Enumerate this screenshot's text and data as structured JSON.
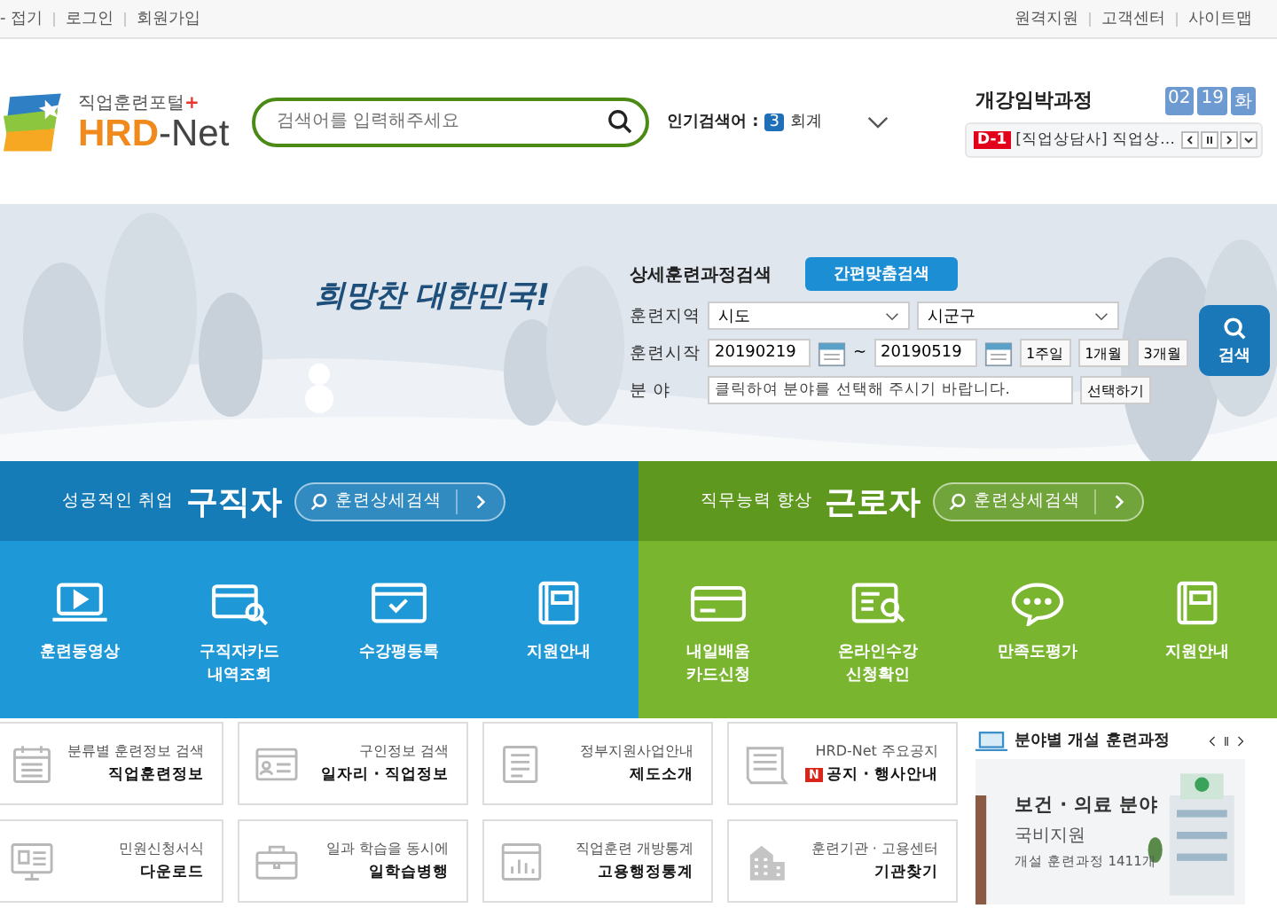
{
  "top_bar": {
    "left_links": [
      "- 접기",
      "로그인",
      "회원가입"
    ],
    "right_links": [
      "원격지원",
      "고객센터",
      "사이트맵"
    ]
  },
  "header": {
    "logo": {
      "tagline": "직업훈련포털",
      "plus": "+",
      "brand": "HRD",
      "suffix": "-Net"
    },
    "search": {
      "placeholder": "검색어를 입력해주세요"
    },
    "popular": {
      "label": "인기검색어 :",
      "rank": "3",
      "term": "회계"
    },
    "upcoming": {
      "title": "개강임박과정",
      "date": [
        "02",
        "19",
        "화"
      ],
      "badge": "D-1",
      "course": "[직업상담사] 직업상…"
    }
  },
  "hero": {
    "slogan": "희망찬 대한민국!",
    "form": {
      "title": "상세훈련과정검색",
      "quick_button": "간편맞춤검색",
      "region_label": "훈련지역",
      "selects": [
        "시도",
        "시군구"
      ],
      "start_label": "훈련시작",
      "from": "20190219",
      "separator": "~",
      "to": "20190519",
      "periods": [
        "1주일",
        "1개월",
        "3개월"
      ],
      "field_label": "분 야",
      "field_placeholder": "클릭하여 분야를 선택해 주시기 바랍니다.",
      "field_button": "선택하기",
      "search_button": "검색"
    }
  },
  "panels": [
    {
      "kind": "jobseeker",
      "subtitle": "성공적인 취업",
      "title": "구직자",
      "search": "훈련상세검색",
      "items": [
        {
          "kind": "video",
          "label": "훈련동영상"
        },
        {
          "kind": "card-search",
          "label": "구직자카드\n내역조회"
        },
        {
          "kind": "window-check",
          "label": "수강평등록"
        },
        {
          "kind": "book",
          "label": "지원안내"
        }
      ]
    },
    {
      "kind": "worker",
      "subtitle": "직무능력 향상",
      "title": "근로자",
      "search": "훈련상세검색",
      "items": [
        {
          "kind": "card",
          "label": "내일배움\n카드신청"
        },
        {
          "kind": "doc-search",
          "label": "온라인수강\n신청확인"
        },
        {
          "kind": "chat",
          "label": "만족도평가"
        },
        {
          "kind": "book",
          "label": "지원안내"
        }
      ]
    }
  ],
  "quick_links": [
    {
      "kind": "calendar",
      "caption": "분류별 훈련정보 검색",
      "title": "직업훈련정보"
    },
    {
      "kind": "id-card",
      "caption": "구인정보 검색",
      "title": "일자리 · 직업정보"
    },
    {
      "kind": "document",
      "caption": "정부지원사업안내",
      "title": "제도소개"
    },
    {
      "kind": "newspaper",
      "caption": "HRD-Net 주요공지",
      "badge": "N",
      "title": "공지 · 행사안내"
    },
    {
      "kind": "monitor",
      "caption": "민원신청서식",
      "title": "다운로드"
    },
    {
      "kind": "briefcase",
      "caption": "일과 학습을 동시에",
      "title": "일학습병행"
    },
    {
      "kind": "chart",
      "caption": "직업훈련 개방통계",
      "title": "고용행정통계"
    },
    {
      "kind": "building",
      "caption": "훈련기관 · 고용센터",
      "title": "기관찾기"
    }
  ],
  "courses": {
    "title": "분야별 개설 훈련과정",
    "card": {
      "field": "보건 · 의료 분야",
      "support": "국비지원",
      "count": "개설 훈련과정 1411개"
    }
  }
}
